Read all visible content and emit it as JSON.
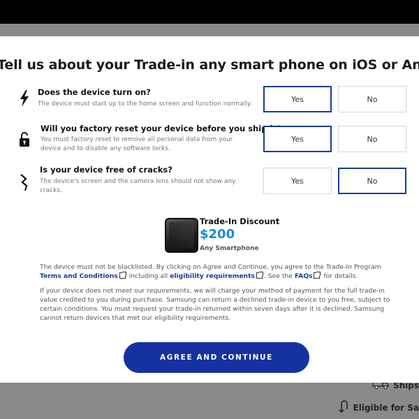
{
  "modal": {
    "title": "Tell us about your Trade-in any smart phone on iOS or Android platform"
  },
  "questions": [
    {
      "title": "Does the device turn on?",
      "description": "The device must start up to the home screen and function normally.",
      "icon": "lightning-bolt-icon",
      "yes_label": "Yes",
      "no_label": "No",
      "selected": "Yes"
    },
    {
      "title": "Will you factory reset your device before you ship it?",
      "description": "You must factory reset to remove all personal data from your device and to disable any software locks.",
      "icon": "unlocked-padlock-icon",
      "yes_label": "Yes",
      "no_label": "No",
      "selected": "Yes"
    },
    {
      "title": "Is your device free of cracks?",
      "description": "The device's screen and the camera lens should not show any cracks.",
      "icon": "crack-icon",
      "yes_label": "Yes",
      "no_label": "No",
      "selected": "No"
    }
  ],
  "discount": {
    "label": "Trade-In Discount",
    "amount": "$200",
    "device": "Any Smartphone"
  },
  "legal": {
    "p1_part1": "The device must not be blacklisted. By clicking on Agree and Continue, you agree to the Trade-In Program",
    "terms_link": "Terms and Conditions",
    "p1_part2": "including all",
    "eligibility_link": "eligibility requirements",
    "p1_part3": ". See the",
    "faqs_link": "FAQs",
    "p1_part4": "for details.",
    "p2": "If your device does not meet our requirements, we will charge your method of payment for the full trade-in value credited to you during purchase. Samsung can return a declined trade-in device to you free, subject to certain conditions. You must request your trade-in returned within seven days after it is declined. Samsung cannot return devices that met our eligibility requirements."
  },
  "agree_button": "AGREE AND CONTINUE",
  "background": {
    "ships_label": "Ships",
    "eligible_label": "Eligible for Sa"
  },
  "colors": {
    "accent": "#1632a1",
    "selected_border": "#1a3d8f",
    "discount_amount": "#1a8bd6"
  }
}
